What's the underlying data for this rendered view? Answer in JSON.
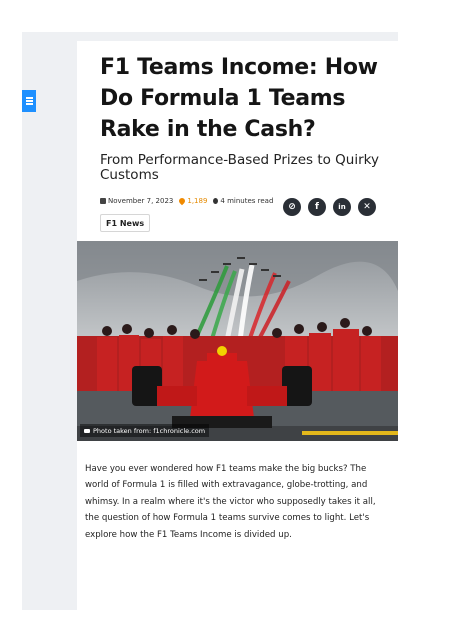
{
  "article": {
    "title": "F1 Teams Income: How Do Formula 1 Teams Rake in the Cash?",
    "subtitle": "From Performance-Based Prizes to Quirky Customs",
    "date": "November 7, 2023",
    "views": "1,189",
    "read_time": "4 minutes read",
    "category": "F1 News",
    "image_caption": "Photo taken from: f1chronicle.com",
    "intro": "Have you ever wondered how F1 teams make the big bucks? The world of Formula 1 is filled with extravagance, globe-trotting, and whimsy. In a realm where it's the victor who supposedly takes it all, the question of how Formula 1 teams survive comes to light. Let's explore how the F1 Teams Income is divided up."
  },
  "share": {
    "link_glyph": "⊘",
    "facebook_glyph": "f",
    "linkedin_glyph": "in",
    "x_glyph": "✕"
  },
  "icons": {
    "sidebar_toggle": "menu-icon",
    "date": "calendar-icon",
    "views": "fire-icon",
    "read_time": "stopwatch-icon",
    "caption": "camera-icon"
  },
  "colors": {
    "accent_blue": "#1e90ff",
    "views_orange": "#e58a00",
    "share_button": "#2a2f36",
    "ferrari_red": "#d21a1a"
  }
}
